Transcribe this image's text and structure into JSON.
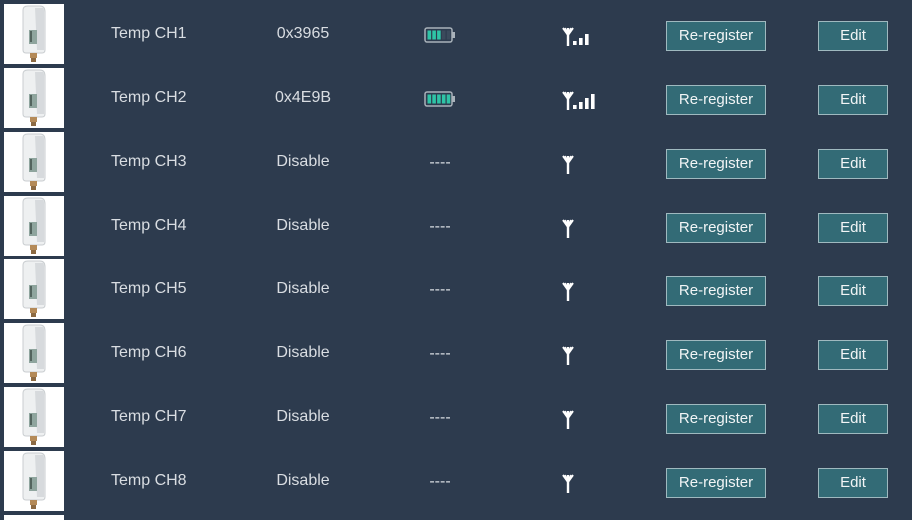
{
  "colors": {
    "background": "#2d3b4e",
    "button": "#336b76",
    "battery": "#2fc4a6"
  },
  "channels": [
    {
      "name": "Temp CH1",
      "address": "0x3965",
      "battery_level": 0.6,
      "signal_bars": 3,
      "battery_text": "----",
      "reregister_label": "Re-register",
      "edit_label": "Edit"
    },
    {
      "name": "Temp CH2",
      "address": "0x4E9B",
      "battery_level": 1.0,
      "signal_bars": 4,
      "battery_text": "----",
      "reregister_label": "Re-register",
      "edit_label": "Edit"
    },
    {
      "name": "Temp CH3",
      "address": "Disable",
      "battery_level": null,
      "signal_bars": 0,
      "battery_text": "----",
      "reregister_label": "Re-register",
      "edit_label": "Edit"
    },
    {
      "name": "Temp CH4",
      "address": "Disable",
      "battery_level": null,
      "signal_bars": 0,
      "battery_text": "----",
      "reregister_label": "Re-register",
      "edit_label": "Edit"
    },
    {
      "name": "Temp CH5",
      "address": "Disable",
      "battery_level": null,
      "signal_bars": 0,
      "battery_text": "----",
      "reregister_label": "Re-register",
      "edit_label": "Edit"
    },
    {
      "name": "Temp CH6",
      "address": "Disable",
      "battery_level": null,
      "signal_bars": 0,
      "battery_text": "----",
      "reregister_label": "Re-register",
      "edit_label": "Edit"
    },
    {
      "name": "Temp CH7",
      "address": "Disable",
      "battery_level": null,
      "signal_bars": 0,
      "battery_text": "----",
      "reregister_label": "Re-register",
      "edit_label": "Edit"
    },
    {
      "name": "Temp CH8",
      "address": "Disable",
      "battery_level": null,
      "signal_bars": 0,
      "battery_text": "----",
      "reregister_label": "Re-register",
      "edit_label": "Edit"
    }
  ],
  "icons": {
    "thumbnail": "sensor-device-icon",
    "battery": "battery-icon",
    "signal": "signal-antenna-icon"
  }
}
